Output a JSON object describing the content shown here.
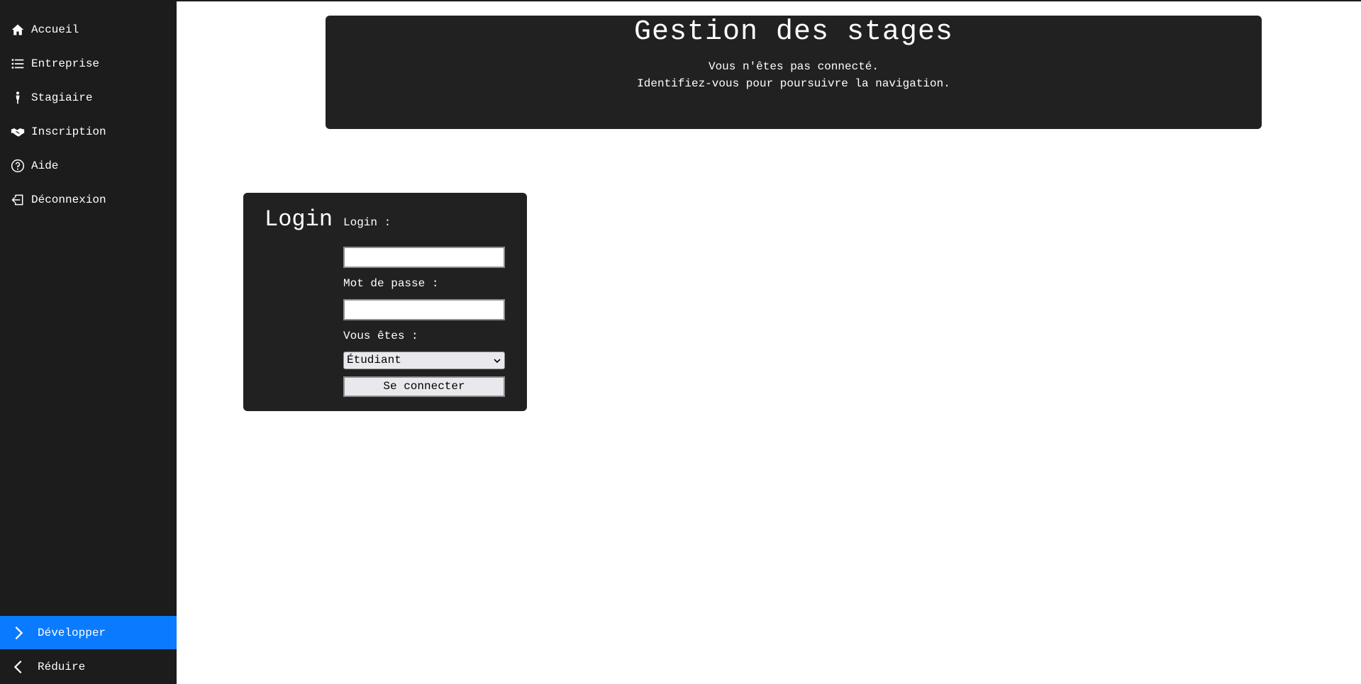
{
  "sidebar": {
    "items": [
      {
        "label": "Accueil",
        "icon": "home-icon"
      },
      {
        "label": "Entreprise",
        "icon": "list-icon"
      },
      {
        "label": "Stagiaire",
        "icon": "person-icon"
      },
      {
        "label": "Inscription",
        "icon": "handshake-icon"
      },
      {
        "label": "Aide",
        "icon": "help-icon"
      },
      {
        "label": "Déconnexion",
        "icon": "logout-icon"
      }
    ],
    "expand_label": "Développer",
    "collapse_label": "Réduire"
  },
  "header": {
    "title": "Gestion des stages",
    "line1": "Vous n'êtes pas connecté.",
    "line2": "Identifiez-vous pour poursuivre la navigation."
  },
  "login": {
    "title": "Login",
    "login_label": "Login :",
    "login_value": "",
    "password_label": "Mot de passe :",
    "password_value": "",
    "type_label": "Vous êtes :",
    "type_selected": "Étudiant",
    "submit_label": "Se connecter"
  },
  "colors": {
    "sidebar_bg": "#1c1c1c",
    "panel_bg": "#212121",
    "accent": "#0a7bff"
  }
}
